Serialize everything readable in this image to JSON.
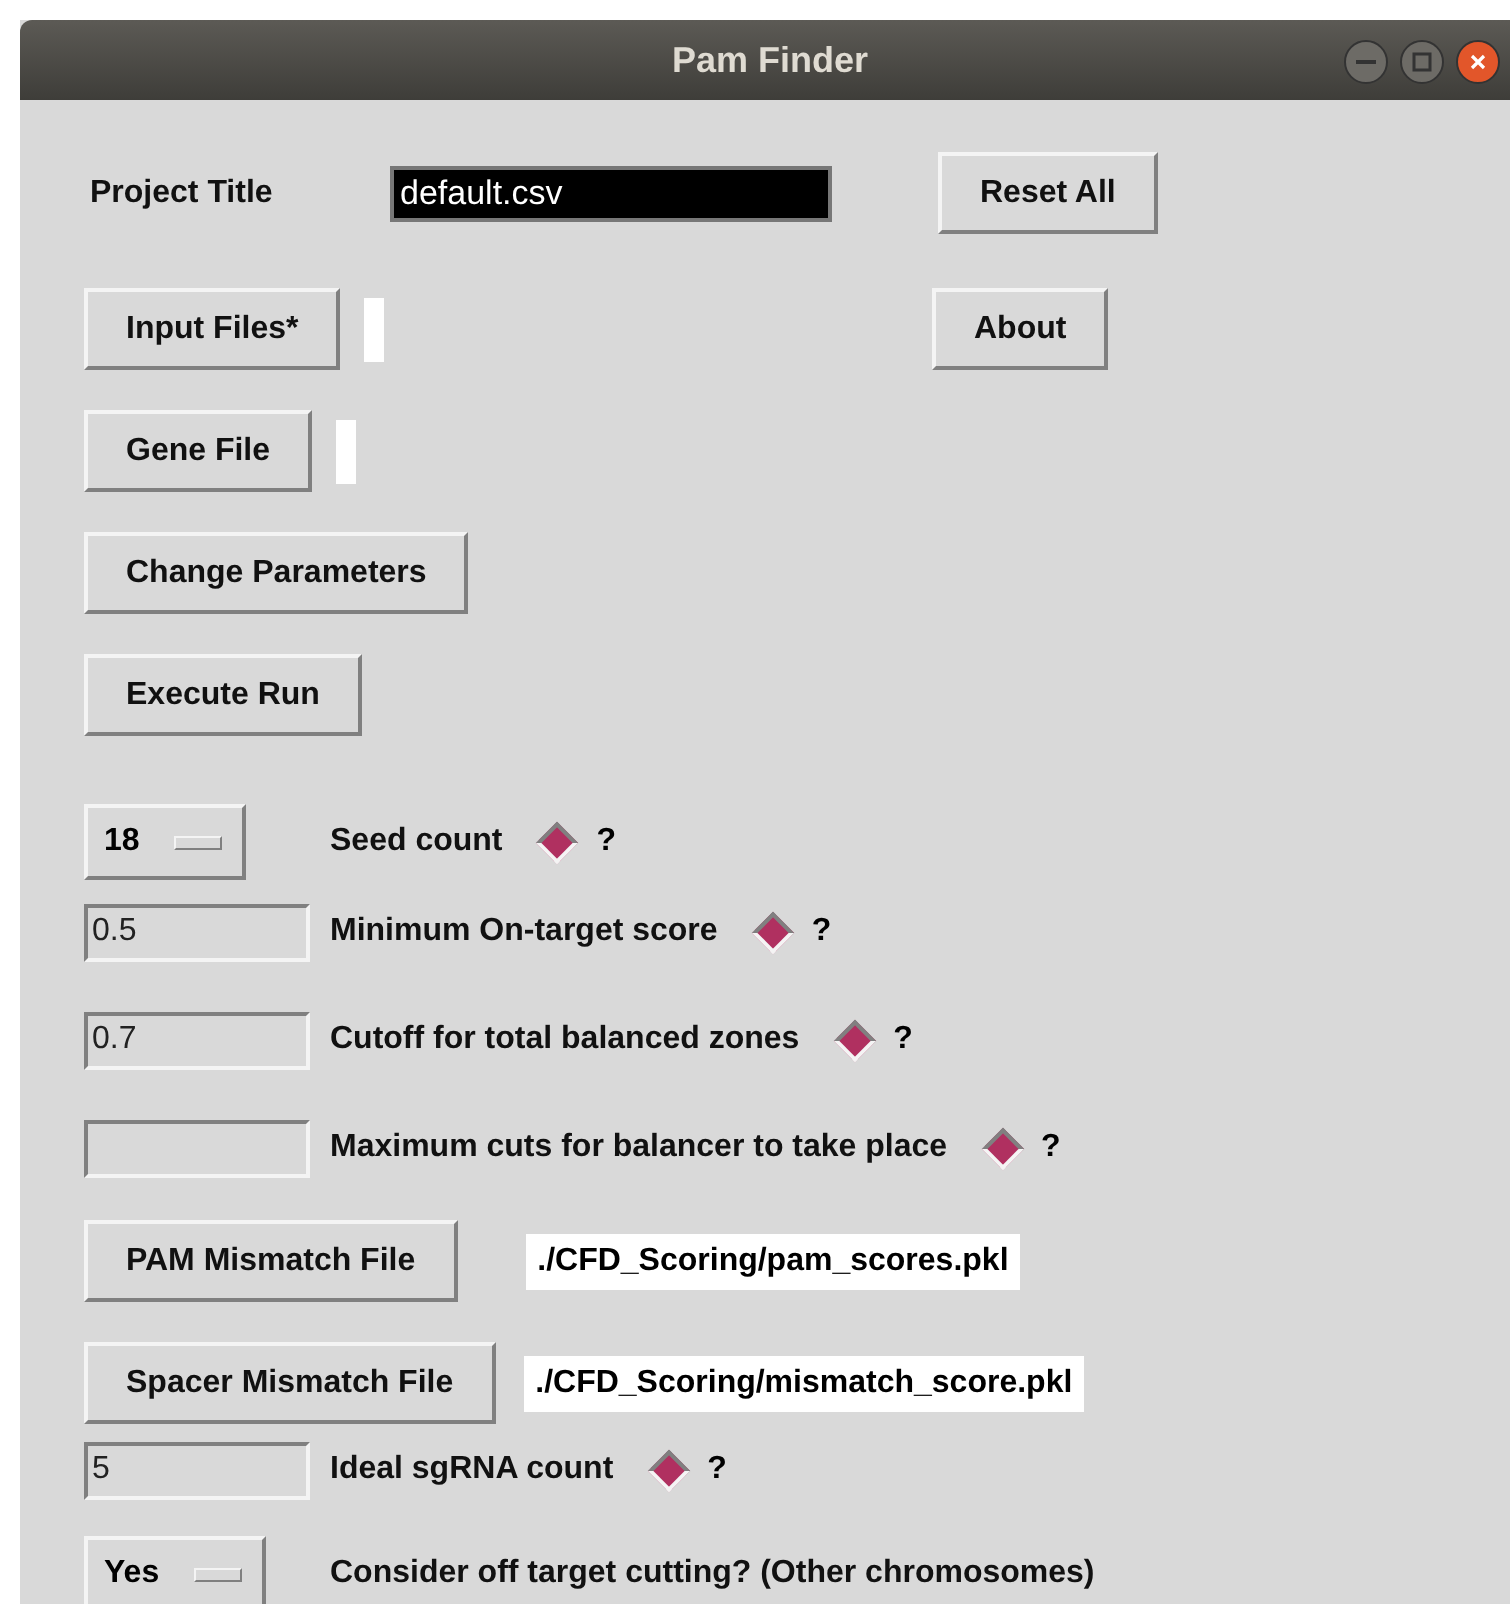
{
  "window": {
    "title": "Pam Finder"
  },
  "project": {
    "label": "Project Title",
    "value": "default.csv",
    "reset_button": "Reset All"
  },
  "file_buttons": [
    {
      "label": "Input Files*"
    },
    {
      "label": "Gene File"
    }
  ],
  "about_button": "About",
  "action_buttons": [
    "Change Parameters",
    "Execute Run"
  ],
  "parameters": [
    {
      "kind": "menu",
      "value": "18",
      "label": "Seed count",
      "selected": true,
      "help": "?"
    },
    {
      "kind": "entry",
      "value": "0.5",
      "label": "Minimum On-target score",
      "selected": true,
      "help": "?"
    },
    {
      "kind": "entry",
      "value": "0.7",
      "label": "Cutoff for total balanced zones",
      "selected": true,
      "help": "?"
    },
    {
      "kind": "entry",
      "label": "Maximum cuts for balancer to take place",
      "selected": true,
      "help": "?"
    }
  ],
  "scoring_files": [
    {
      "button": "PAM Mismatch File",
      "path": "./CFD_Scoring/pam_scores.pkl"
    },
    {
      "button": "Spacer Mismatch File",
      "path": "./CFD_Scoring/mismatch_score.pkl"
    }
  ],
  "extra_parameters": [
    {
      "kind": "entry",
      "value": "5",
      "label": "Ideal sgRNA count",
      "selected": true,
      "help": "?"
    },
    {
      "kind": "menu",
      "value": "Yes",
      "label": "Consider off target cutting? (Other chromosomes)"
    }
  ]
}
